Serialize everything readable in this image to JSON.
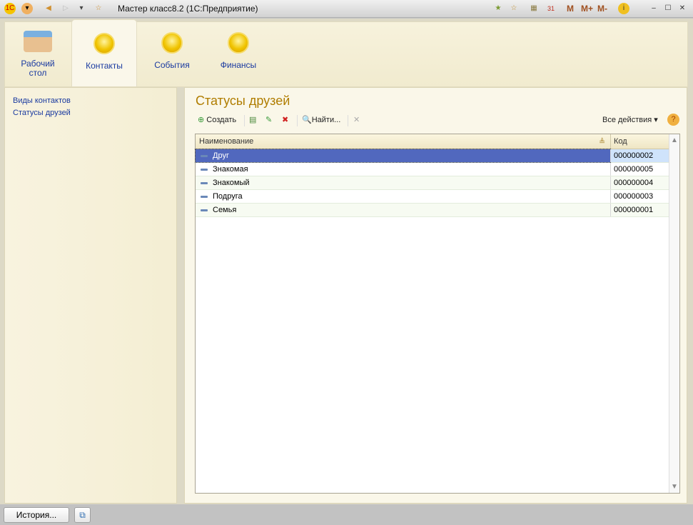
{
  "window": {
    "title": "Мастер класс8.2  (1С:Предприятие)",
    "memory": [
      "M",
      "M+",
      "M-"
    ]
  },
  "sections": [
    {
      "label1": "Рабочий",
      "label2": "стол"
    },
    {
      "label1": "Контакты"
    },
    {
      "label1": "События"
    },
    {
      "label1": "Финансы"
    }
  ],
  "nav": [
    "Виды контактов",
    "Статусы друзей"
  ],
  "form": {
    "title": "Статусы друзей",
    "create": "Создать",
    "find": "Найти...",
    "all_actions": "Все действия ▾"
  },
  "table": {
    "columns": [
      "Наименование",
      "Код"
    ],
    "rows": [
      {
        "name": "Друг",
        "code": "000000002"
      },
      {
        "name": "Знакомая",
        "code": "000000005"
      },
      {
        "name": "Знакомый",
        "code": "000000004"
      },
      {
        "name": "Подруга",
        "code": "000000003"
      },
      {
        "name": "Семья",
        "code": "000000001"
      }
    ]
  },
  "status": {
    "history": "История..."
  }
}
